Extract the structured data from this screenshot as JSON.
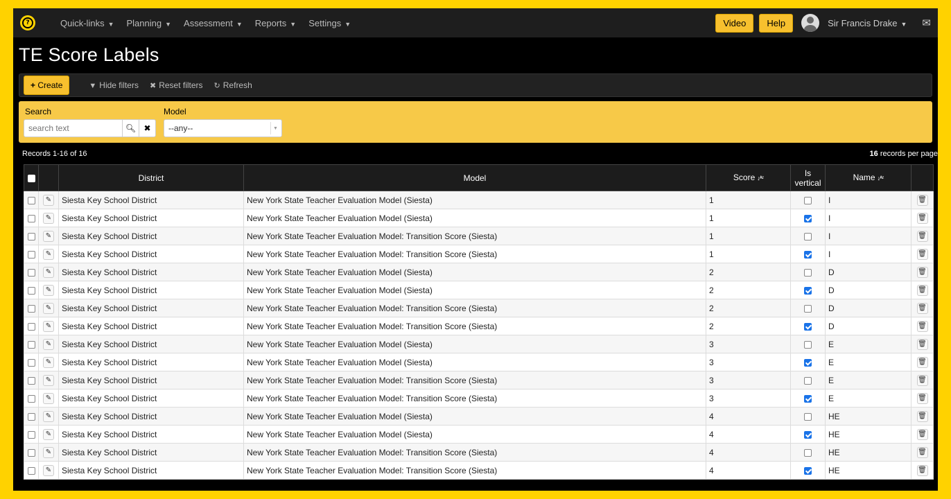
{
  "nav": {
    "menu": [
      {
        "label": "Quick-links"
      },
      {
        "label": "Planning"
      },
      {
        "label": "Assessment"
      },
      {
        "label": "Reports"
      },
      {
        "label": "Settings"
      }
    ],
    "video_label": "Video",
    "help_label": "Help",
    "user_name": "Sir Francis Drake"
  },
  "page": {
    "title": "TE Score Labels"
  },
  "toolbar": {
    "create_label": "Create",
    "hide_filters_label": "Hide filters",
    "reset_filters_label": "Reset filters",
    "refresh_label": "Refresh"
  },
  "filters": {
    "search_label": "Search",
    "search_placeholder": "search text",
    "model_label": "Model",
    "model_value": "--any--"
  },
  "records": {
    "summary": "Records 1-16 of 16",
    "per_page_count": "16",
    "per_page_label": "records per page"
  },
  "table": {
    "headers": {
      "district": "District",
      "model": "Model",
      "score": "Score",
      "is_vertical_line1": "Is",
      "is_vertical_line2": "vertical",
      "name": "Name"
    },
    "rows": [
      {
        "district": "Siesta Key School District",
        "model": "New York State Teacher Evaluation Model (Siesta)",
        "score": "1",
        "vertical": false,
        "name": "I"
      },
      {
        "district": "Siesta Key School District",
        "model": "New York State Teacher Evaluation Model (Siesta)",
        "score": "1",
        "vertical": true,
        "name": "I"
      },
      {
        "district": "Siesta Key School District",
        "model": "New York State Teacher Evaluation Model: Transition Score (Siesta)",
        "score": "1",
        "vertical": false,
        "name": "I"
      },
      {
        "district": "Siesta Key School District",
        "model": "New York State Teacher Evaluation Model: Transition Score (Siesta)",
        "score": "1",
        "vertical": true,
        "name": "I"
      },
      {
        "district": "Siesta Key School District",
        "model": "New York State Teacher Evaluation Model (Siesta)",
        "score": "2",
        "vertical": false,
        "name": "D"
      },
      {
        "district": "Siesta Key School District",
        "model": "New York State Teacher Evaluation Model (Siesta)",
        "score": "2",
        "vertical": true,
        "name": "D"
      },
      {
        "district": "Siesta Key School District",
        "model": "New York State Teacher Evaluation Model: Transition Score (Siesta)",
        "score": "2",
        "vertical": false,
        "name": "D"
      },
      {
        "district": "Siesta Key School District",
        "model": "New York State Teacher Evaluation Model: Transition Score (Siesta)",
        "score": "2",
        "vertical": true,
        "name": "D"
      },
      {
        "district": "Siesta Key School District",
        "model": "New York State Teacher Evaluation Model (Siesta)",
        "score": "3",
        "vertical": false,
        "name": "E"
      },
      {
        "district": "Siesta Key School District",
        "model": "New York State Teacher Evaluation Model (Siesta)",
        "score": "3",
        "vertical": true,
        "name": "E"
      },
      {
        "district": "Siesta Key School District",
        "model": "New York State Teacher Evaluation Model: Transition Score (Siesta)",
        "score": "3",
        "vertical": false,
        "name": "E"
      },
      {
        "district": "Siesta Key School District",
        "model": "New York State Teacher Evaluation Model: Transition Score (Siesta)",
        "score": "3",
        "vertical": true,
        "name": "E"
      },
      {
        "district": "Siesta Key School District",
        "model": "New York State Teacher Evaluation Model (Siesta)",
        "score": "4",
        "vertical": false,
        "name": "HE"
      },
      {
        "district": "Siesta Key School District",
        "model": "New York State Teacher Evaluation Model (Siesta)",
        "score": "4",
        "vertical": true,
        "name": "HE"
      },
      {
        "district": "Siesta Key School District",
        "model": "New York State Teacher Evaluation Model: Transition Score (Siesta)",
        "score": "4",
        "vertical": false,
        "name": "HE"
      },
      {
        "district": "Siesta Key School District",
        "model": "New York State Teacher Evaluation Model: Transition Score (Siesta)",
        "score": "4",
        "vertical": true,
        "name": "HE"
      }
    ]
  },
  "icons": {
    "logo": "lightbulb-logo-icon",
    "caret": "caret-down-icon",
    "envelope": "envelope-icon",
    "create": "plus-icon",
    "filter": "filter-icon",
    "reset": "times-icon",
    "refresh": "refresh-icon",
    "search": "search-icon",
    "clear": "times-icon",
    "edit": "pencil-icon",
    "delete": "trash-icon",
    "sort": "sort-alpha-icon"
  },
  "colors": {
    "accent": "#f7c02e",
    "filter_panel": "#f7c948",
    "frame_border": "#ffd200",
    "checked": "#1a73e8"
  }
}
